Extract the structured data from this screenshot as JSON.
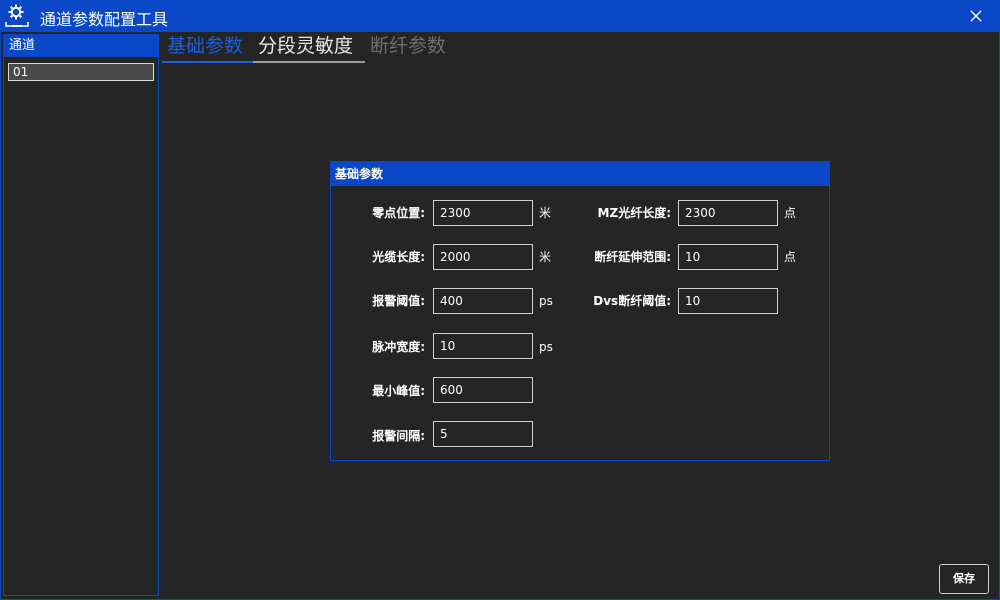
{
  "window": {
    "title": "通道参数配置工具",
    "icon": "gear-settings-icon",
    "close": "close-icon"
  },
  "colors": {
    "accent": "#0a48c8",
    "background": "#252525",
    "active_tab": "#1a5fe0",
    "inactive_tab": "#e6e6e6",
    "disabled_tab": "#6e6e6e"
  },
  "sidebar": {
    "header": "通道",
    "items": [
      {
        "label": "01",
        "selected": true
      }
    ]
  },
  "tabs": [
    {
      "label": "基础参数",
      "state": "active"
    },
    {
      "label": "分段灵敏度",
      "state": "normal"
    },
    {
      "label": "断纤参数",
      "state": "disabled"
    }
  ],
  "panel": {
    "title": "基础参数",
    "left_fields": [
      {
        "label": "零点位置:",
        "value": "2300",
        "unit": "米"
      },
      {
        "label": "光缆长度:",
        "value": "2000",
        "unit": "米"
      },
      {
        "label": "报警阈值:",
        "value": "400",
        "unit": "ps"
      },
      {
        "label": "脉冲宽度:",
        "value": "10",
        "unit": "ps"
      },
      {
        "label": "最小峰值:",
        "value": "600",
        "unit": ""
      },
      {
        "label": "报警间隔:",
        "value": "5",
        "unit": ""
      }
    ],
    "right_fields": [
      {
        "label": "MZ光纤长度:",
        "value": "2300",
        "unit": "点"
      },
      {
        "label": "断纤延伸范围:",
        "value": "10",
        "unit": "点"
      },
      {
        "label": "Dvs断纤阈值:",
        "value": "10",
        "unit": ""
      }
    ]
  },
  "footer": {
    "save_label": "保存"
  }
}
